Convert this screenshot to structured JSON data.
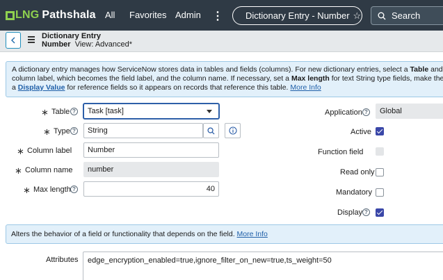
{
  "nav": {
    "logo_lng": "LNG",
    "logo_pathshala": "Pathshala",
    "all": "All",
    "favorites": "Favorites",
    "admin": "Admin",
    "more": "⋮",
    "record_pill": "Dictionary Entry - Number",
    "search": "Search"
  },
  "header": {
    "title_line1": "Dictionary Entry",
    "title_name": "Number",
    "title_view": "View: Advanced*"
  },
  "info": {
    "line1_a": "A dictionary entry manages how ServiceNow stores data in tables and fields (columns). For new dictionary entries, select a ",
    "line1_table": "Table",
    "line1_b": " and the fiel",
    "line2_a": "column label, which becomes the field label, and the column name. If necessary, set a ",
    "line2_maxlen": "Max length",
    "line2_b": " for text String type fields, make the field ",
    "line2_ma": "Ma",
    "line3_a": "a ",
    "line3_display": "Display Value",
    "line3_b": " for reference fields so it appears on records that reference this table. ",
    "line3_more": "More Info"
  },
  "form": {
    "table_label": "Table",
    "table_value": "Task [task]",
    "type_label": "Type",
    "type_value": "String",
    "column_label_label": "Column label",
    "column_label_value": "Number",
    "column_name_label": "Column name",
    "column_name_value": "number",
    "max_length_label": "Max length",
    "max_length_value": "40",
    "application_label": "Application",
    "application_value": "Global",
    "active_label": "Active",
    "function_field_label": "Function field",
    "read_only_label": "Read only",
    "mandatory_label": "Mandatory",
    "display_label": "Display",
    "required_mark": "∗",
    "help_mark": "?"
  },
  "checkboxes": {
    "active": true,
    "function_field": false,
    "read_only": false,
    "mandatory": false,
    "display": true
  },
  "alter": {
    "text": "Alters the behavior of a field or functionality that depends on the field. ",
    "more": "More Info"
  },
  "attributes": {
    "label": "Attributes",
    "value": "edge_encryption_enabled=true,ignore_filter_on_new=true,ts_weight=50"
  },
  "colors": {
    "nav_bg": "#2f3a45",
    "logo_green": "#8fd14f",
    "info_bg": "#e2f0fa",
    "checkbox_checked": "#3a47a8",
    "link": "#1f5fa8"
  }
}
